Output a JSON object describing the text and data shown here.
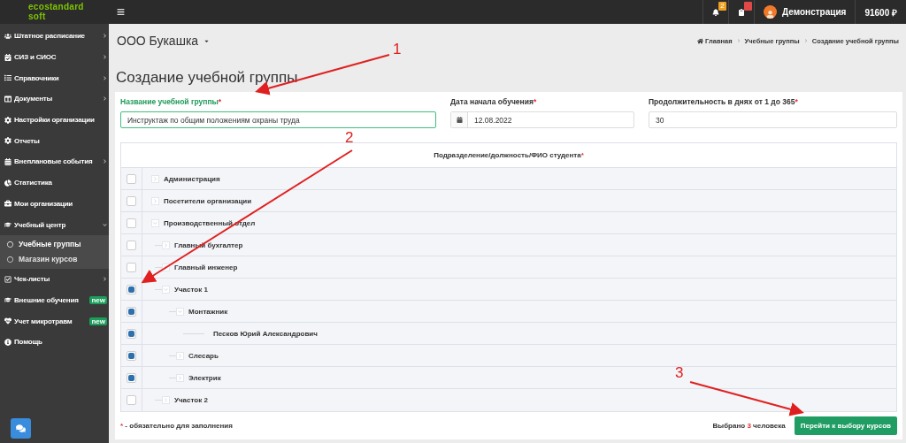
{
  "topbar": {
    "logo": [
      "ecostandard",
      "soft"
    ],
    "notifications_badge": "2",
    "user_name": "Демонстрация",
    "balance": "91600 ₽"
  },
  "sidebar": {
    "items": [
      {
        "label": "Штатное расписание",
        "submenu": true
      },
      {
        "label": "СИЗ и СИОС",
        "submenu": true
      },
      {
        "label": "Справочники",
        "submenu": true
      },
      {
        "label": "Документы",
        "submenu": true
      },
      {
        "label": "Настройки организации",
        "submenu": false
      },
      {
        "label": "Отчеты",
        "submenu": false
      },
      {
        "label": "Внеплановые события",
        "submenu": true
      },
      {
        "label": "Статистика",
        "submenu": false
      },
      {
        "label": "Мои организации",
        "submenu": false
      },
      {
        "label": "Учебный центр",
        "submenu": true,
        "expanded": true,
        "children": [
          {
            "label": "Учебные группы",
            "selected": true
          },
          {
            "label": "Магазин курсов",
            "selected": false
          }
        ]
      },
      {
        "label": "Чек-листы",
        "submenu": true
      },
      {
        "label": "Внешние обучения",
        "submenu": false,
        "badge": "new"
      },
      {
        "label": "Учет микротравм",
        "submenu": false,
        "badge": "new"
      },
      {
        "label": "Помощь",
        "submenu": false
      }
    ]
  },
  "organization": "ООО Букашка",
  "breadcrumbs": [
    "Главная",
    "Учебные группы",
    "Создание учебной группы"
  ],
  "page_title": "Создание учебной группы",
  "required_mark": "*",
  "fields": [
    {
      "label": "Название учебной группы",
      "value": "Инструктаж по общим положениям охраны труда",
      "focused": true,
      "kind": "text"
    },
    {
      "label": "Дата начала обучения",
      "value": "12.08.2022",
      "focused": false,
      "kind": "date"
    },
    {
      "label": "Продолжительность в днях от 1 до 365",
      "value": "30",
      "focused": false,
      "kind": "text"
    }
  ],
  "tree": {
    "heading": "Подразделение/должность/ФИО студента",
    "nodes": [
      {
        "label": "Администрация",
        "checked": false,
        "expanded": false
      },
      {
        "label": "Посетители организации",
        "checked": false,
        "expanded": false
      },
      {
        "label": "Производственный отдел",
        "checked": false,
        "expanded": true,
        "children": [
          {
            "label": "Главный бухгалтер",
            "checked": false,
            "expanded": false
          },
          {
            "label": "Главный инженер",
            "checked": false,
            "expanded": false
          },
          {
            "label": "Участок 1",
            "checked": true,
            "expanded": true,
            "children": [
              {
                "label": "Монтажник",
                "checked": true,
                "expanded": true,
                "children": [
                  {
                    "label": "Песков Юрий Александрович",
                    "checked": true,
                    "kind": "person"
                  }
                ]
              },
              {
                "label": "Слесарь",
                "checked": true,
                "expanded": false
              },
              {
                "label": "Электрик",
                "checked": true,
                "expanded": false
              }
            ]
          },
          {
            "label": "Участок 2",
            "checked": false,
            "expanded": false
          }
        ]
      }
    ]
  },
  "footer": {
    "note": "- обязательно для заполнения",
    "selected_prefix": "Выбрано",
    "selected_count": "3",
    "selected_suffix": "человека",
    "button": "Перейти к выбору курсов"
  },
  "annotations": [
    "1",
    "2",
    "3"
  ]
}
